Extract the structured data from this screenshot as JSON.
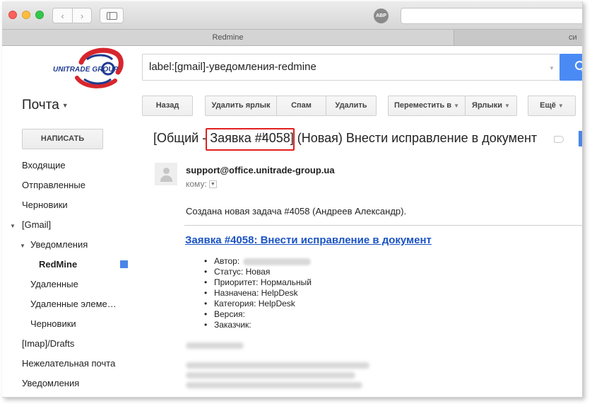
{
  "browser": {
    "tab_active": "Redmine",
    "tab_other": "си",
    "abp_label": "ABP",
    "back_glyph": "‹",
    "forward_glyph": "›"
  },
  "logo": {
    "text": "UNITRADE GROUP",
    "colors": {
      "red": "#d7262d",
      "blue": "#1f3a8f"
    }
  },
  "search": {
    "value": "label:[gmail]-уведомления-redmine",
    "icon": "search-icon",
    "button_color": "#4a8af4"
  },
  "mail_menu": {
    "label": "Почта",
    "caret": "▼"
  },
  "toolbar": {
    "back": "Назад",
    "remove_label": "Удалить ярлык",
    "spam": "Спам",
    "delete": "Удалить",
    "move_to": "Переместить в",
    "labels": "Ярлыки",
    "more": "Ещё",
    "caret": "▼"
  },
  "compose": {
    "label": "НАПИСАТЬ"
  },
  "nav": {
    "inbox": "Входящие",
    "sent": "Отправленные",
    "drafts": "Черновики",
    "gmail": "[Gmail]",
    "notifications": "Уведомления",
    "redmine": "RedMine",
    "deleted": "Удаленные",
    "deleted_items": "Удаленные элеме…",
    "drafts_sub": "Черновики",
    "imap_drafts": "[Imap]/Drafts",
    "junk": "Нежелательная почта",
    "notifications_2": "Уведомления",
    "arrow": "▼",
    "label_color": "#4a86e8"
  },
  "message": {
    "subject_prefix": "[Общий - ",
    "subject_issue": "Заявка #4058]",
    "subject_rest": " (Новая) Внести исправление в документ",
    "highlight_color": "#e0201e",
    "sender": "support@office.unitrade-group.ua",
    "to_label": "кому:",
    "to_caret": "▼",
    "intro": "Создана новая задача #4058 (Андреев Александр).",
    "issue_link": "Заявка #4058: Внести исправление в документ",
    "fields": [
      "Автор:",
      "Статус: Новая",
      "Приоритет: Нормальный",
      "Назначена: HelpDesk",
      "Категория: HelpDesk",
      "Версия:",
      "Заказчик:"
    ]
  }
}
